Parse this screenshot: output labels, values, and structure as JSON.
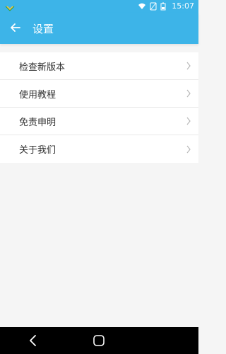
{
  "status_bar": {
    "time": "15:07",
    "icons": [
      "notification-icon",
      "wifi-icon",
      "no-sim-icon",
      "battery-icon"
    ]
  },
  "header": {
    "title": "设置",
    "back_icon": "arrow-left-icon"
  },
  "settings_list": {
    "items": [
      {
        "label": "检查新版本",
        "icon": "chevron-right-icon"
      },
      {
        "label": "使用教程",
        "icon": "chevron-right-icon"
      },
      {
        "label": "免责申明",
        "icon": "chevron-right-icon"
      },
      {
        "label": "关于我们",
        "icon": "chevron-right-icon"
      }
    ]
  },
  "nav_bar": {
    "buttons": [
      "back-icon",
      "home-icon"
    ]
  },
  "colors": {
    "accent": "#3db4e8",
    "background": "#f5f5f5",
    "list_background": "#ffffff",
    "text": "#333333",
    "nav_bar": "#000000"
  }
}
